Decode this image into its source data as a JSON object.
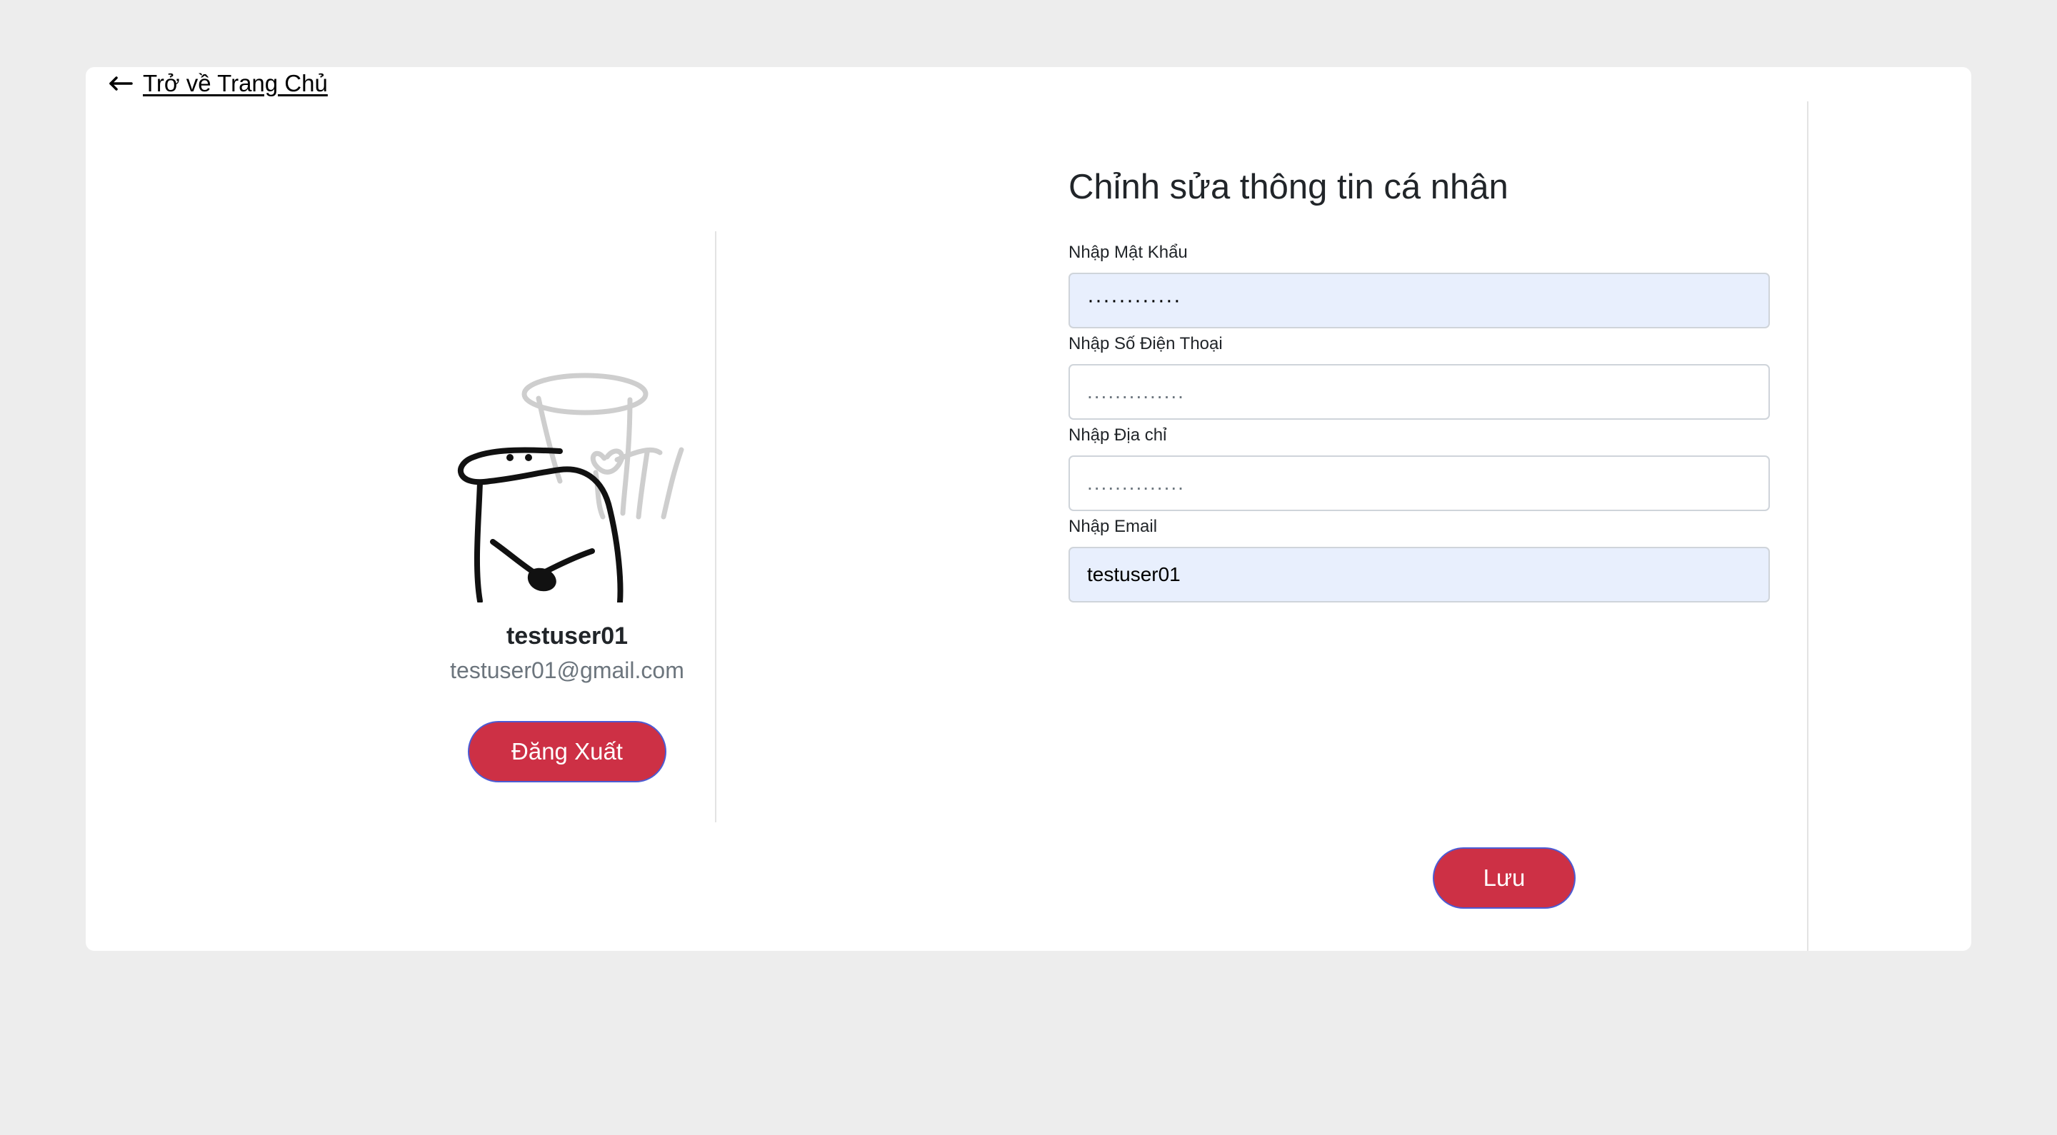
{
  "nav": {
    "back_label": "Trở về Trang Chủ"
  },
  "profile": {
    "username": "testuser01",
    "email": "testuser01@gmail.com",
    "logout_label": "Đăng Xuất"
  },
  "form": {
    "title": "Chỉnh sửa thông tin cá nhân",
    "password": {
      "label": "Nhập Mật Khẩu",
      "value": "············"
    },
    "phone": {
      "label": "Nhập Số Điện Thoại",
      "placeholder": ".............."
    },
    "address": {
      "label": "Nhập Địa chỉ",
      "placeholder": ".............."
    },
    "email": {
      "label": "Nhập Email",
      "value": "testuser01"
    },
    "save_label": "Lưu"
  },
  "colors": {
    "page_background": "#ededed",
    "card_background": "#ffffff",
    "button_red": "#cd3045",
    "button_border": "#4c5bd4",
    "autofill_background": "#e8effd"
  },
  "icons": {
    "back": "arrow-left-icon",
    "avatar": "avatar-drawing"
  }
}
